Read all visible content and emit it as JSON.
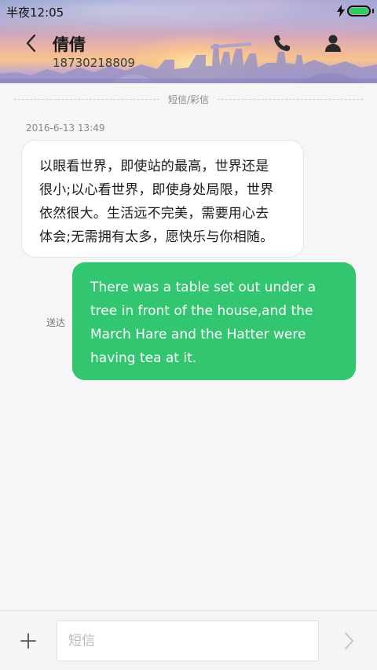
{
  "status_bar": {
    "time": "半夜12:05",
    "battery_level": 1.0,
    "charging": true,
    "battery_color": "#2ecc5a"
  },
  "header": {
    "contact_name": "倩倩",
    "contact_number": "18730218809",
    "icons": [
      "back-arrow-icon",
      "phone-icon",
      "profile-icon"
    ]
  },
  "conversation": {
    "divider_label": "短信/彩信",
    "timestamp": "2016-6-13 13:49",
    "received": {
      "lines": [
        "以眼看世界，即使站的最高，世界还是",
        "很小;以心看世界，即使身处局限，世界",
        "依然很大。生活远不完美，需要用心去",
        "体会;无需拥有太多，愿快乐与你相随。"
      ]
    },
    "sent": {
      "status": "送达",
      "color": "#33c670",
      "lines": [
        "There was a table set out under a",
        "tree in front of the house,and the",
        "March Hare and the Hatter were",
        "having tea at it."
      ]
    }
  },
  "composer": {
    "placeholder": "短信",
    "value": "",
    "icons": [
      "plus-icon",
      "send-arrow-icon"
    ]
  }
}
